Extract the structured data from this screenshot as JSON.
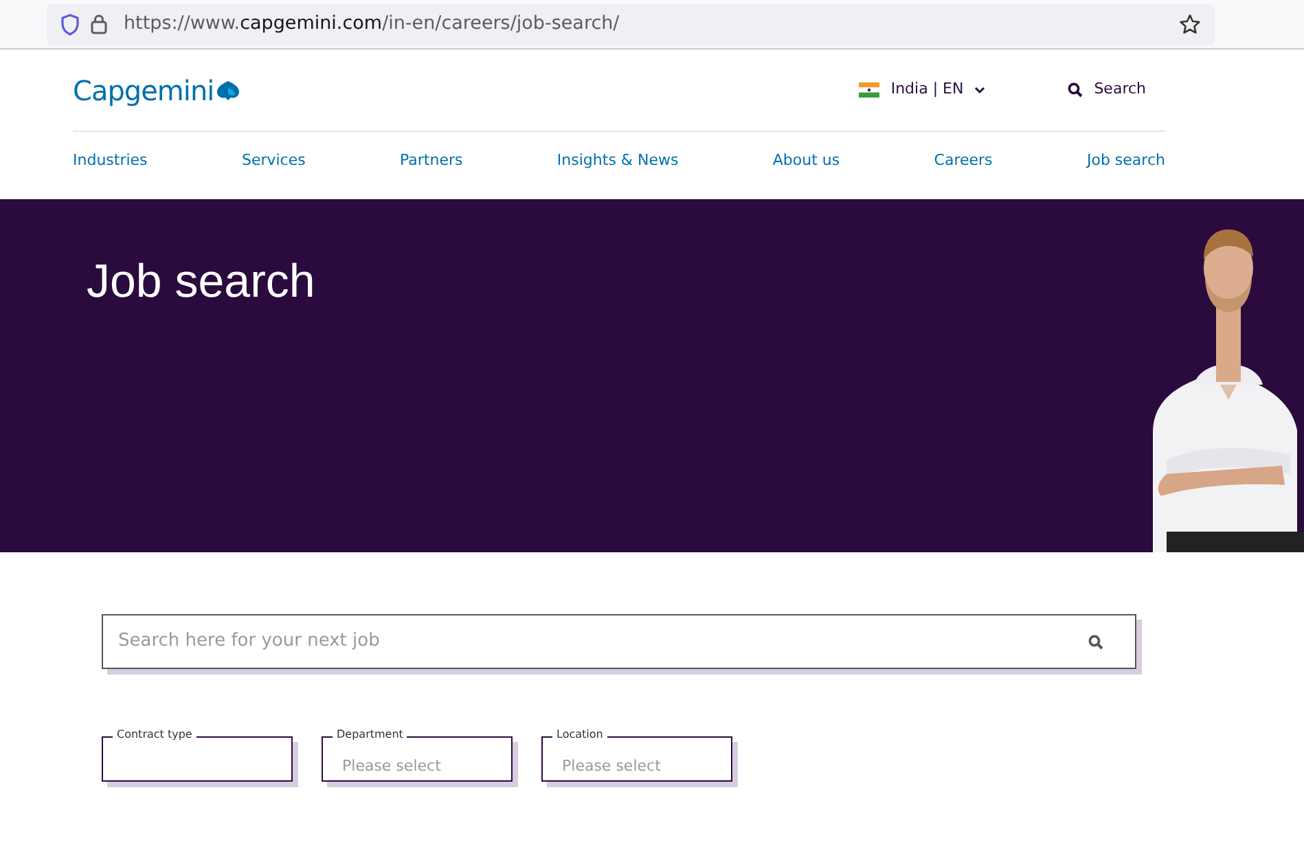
{
  "browser": {
    "url": {
      "scheme": "https://www.",
      "domain": "capgemini.com",
      "path": "/in-en/careers/job-search/"
    }
  },
  "header": {
    "logo": "Capgemini",
    "language": "India | EN",
    "search": "Search",
    "nav": [
      "Industries",
      "Services",
      "Partners",
      "Insights & News",
      "About us",
      "Careers",
      "Job search"
    ]
  },
  "hero": {
    "title": "Job search"
  },
  "job_search": {
    "placeholder": "Search here for your next job"
  },
  "filters": [
    {
      "label": "Contract type"
    },
    {
      "label": "Department",
      "placeholder": "Please select"
    },
    {
      "label": "Location",
      "placeholder": "Please select"
    }
  ]
}
